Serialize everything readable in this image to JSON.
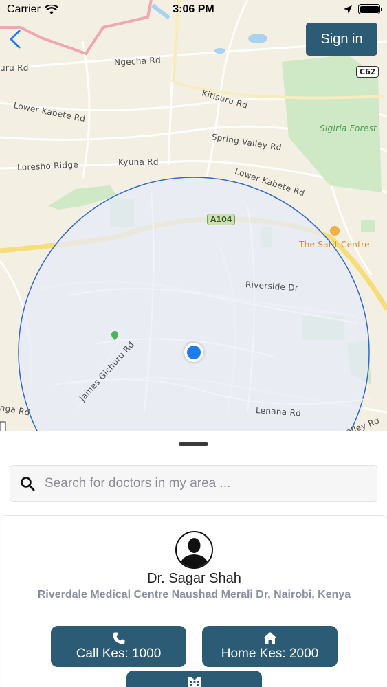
{
  "status_bar": {
    "carrier": "Carrier",
    "time": "3:06 PM"
  },
  "nav": {
    "sign_in_label": "Sign in"
  },
  "map": {
    "labels": {
      "uru_rd": "uru Rd",
      "ngecha_rd": "Ngecha Rd",
      "kitisuru_rd": "Kitisuru Rd",
      "lower_kabete_rd_top": "Lower Kabete Rd",
      "sigiria_forest": "Sigiria Forest",
      "spring_valley_rd": "Spring Valley Rd",
      "loresho_ridge": "Loresho Ridge",
      "kyuna_rd": "Kyuna Rd",
      "lower_kabete_rd_right": "Lower Kabete Rd",
      "sarit_centre": "The Sarit Centre",
      "riverside_dr": "Riverside Dr",
      "james_gichuru_rd": "James Gichuru Rd",
      "nga_rd": "nga Rd",
      "lenana_rd": "Lenana Rd",
      "valley_rd": "alley Rd"
    },
    "shields": {
      "a104": "A104",
      "c62": "C62"
    },
    "colors": {
      "land": "#f4efe3",
      "park": "#cfe8c5",
      "road_major": "#f5dd7a",
      "radius_fill": "#e6eaf6",
      "radius_stroke": "#2d68d3",
      "location": "#1b7cf0"
    }
  },
  "search": {
    "placeholder": "Search for doctors in my area ...",
    "value": ""
  },
  "doctor": {
    "name": "Dr. Sagar Shah",
    "address": "Riverdale Medical Centre Naushad Merali Dr, Nairobi, Kenya",
    "actions": {
      "call": {
        "label": "Call Kes: 1000",
        "icon": "phone-icon"
      },
      "home": {
        "label": "Home Kes: 2000",
        "icon": "home-icon"
      },
      "clinic": {
        "label": "",
        "icon": "hospital-icon"
      }
    }
  },
  "accent_color": "#2c5b75"
}
